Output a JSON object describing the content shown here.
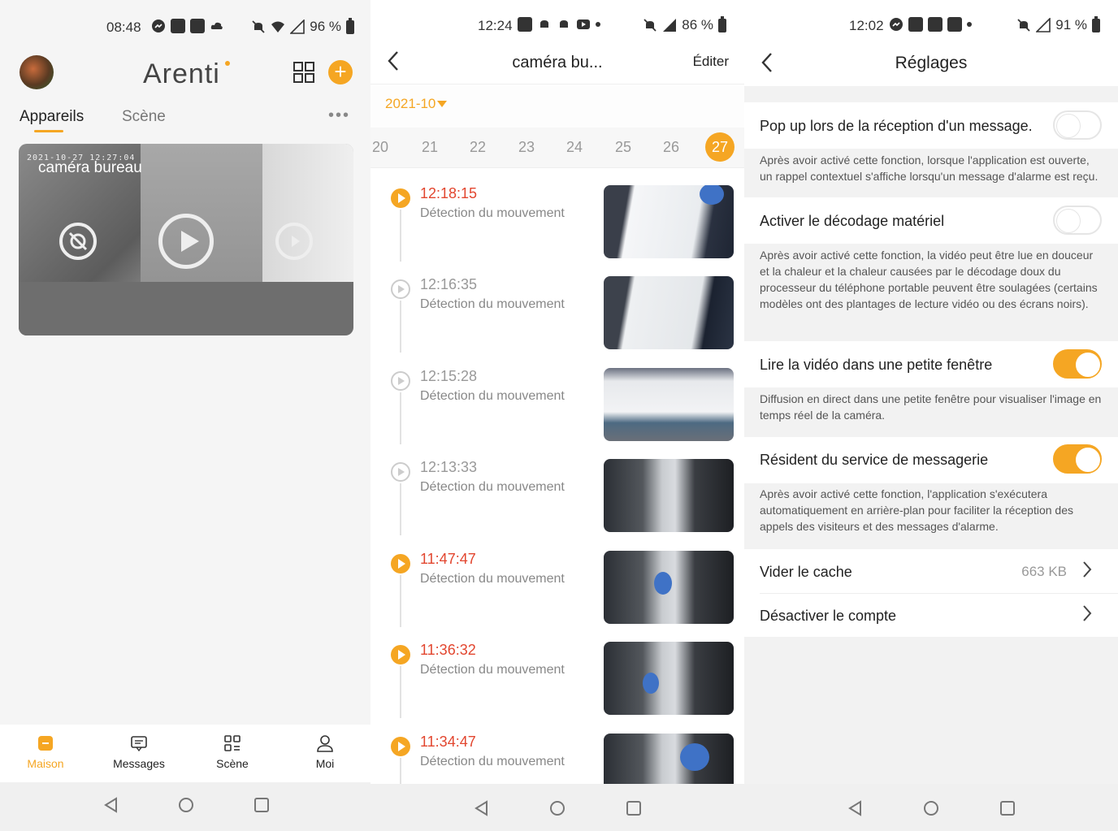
{
  "panel1": {
    "status": {
      "time": "08:48",
      "battery": "96 %"
    },
    "logo": "Arenti",
    "tabs": [
      {
        "label": "Appareils"
      },
      {
        "label": "Scène"
      }
    ],
    "more": "•••",
    "camera": {
      "timestamp": "2021-10-27 12:27:04",
      "name": "caméra bureau"
    },
    "bottom_nav": [
      {
        "label": "Maison",
        "icon": "home-icon"
      },
      {
        "label": "Messages",
        "icon": "message-icon"
      },
      {
        "label": "Scène",
        "icon": "scene-grid-icon"
      },
      {
        "label": "Moi",
        "icon": "person-icon"
      }
    ],
    "add_symbol": "+"
  },
  "panel2": {
    "status": {
      "time": "12:24",
      "battery": "86 %"
    },
    "title": "caméra bu...",
    "edit": "Éditer",
    "month": "2021-10",
    "days": [
      "20",
      "21",
      "22",
      "23",
      "24",
      "25",
      "26",
      "27"
    ],
    "active_day": "27",
    "events": [
      {
        "time": "12:18:15",
        "label": "Détection du mouvement",
        "unread": true
      },
      {
        "time": "12:16:35",
        "label": "Détection du mouvement",
        "unread": false
      },
      {
        "time": "12:15:28",
        "label": "Détection du mouvement",
        "unread": false
      },
      {
        "time": "12:13:33",
        "label": "Détection du mouvement",
        "unread": false
      },
      {
        "time": "11:47:47",
        "label": "Détection du mouvement",
        "unread": true
      },
      {
        "time": "11:36:32",
        "label": "Détection du mouvement",
        "unread": true
      },
      {
        "time": "11:34:47",
        "label": "Détection du mouvement",
        "unread": true
      }
    ]
  },
  "panel3": {
    "status": {
      "time": "12:02",
      "battery": "91 %"
    },
    "title": "Réglages",
    "settings": [
      {
        "label": "Pop up lors de la réception d'un message.",
        "on": false,
        "desc": "Après avoir activé cette fonction, lorsque l'application est ouverte, un rappel contextuel s'affiche lorsqu'un message d'alarme est reçu."
      },
      {
        "label": "Activer le décodage matériel",
        "on": false,
        "desc": "Après avoir activé cette fonction, la vidéo peut être lue en douceur et la chaleur et la chaleur causées par le décodage doux du processeur du téléphone portable peuvent être soulagées (certains modèles ont des plantages de lecture vidéo ou des écrans noirs)."
      },
      {
        "label": "Lire la vidéo dans une petite fenêtre",
        "on": true,
        "desc": "Diffusion en direct dans une petite fenêtre pour visualiser l'image en temps réel de la caméra."
      },
      {
        "label": "Résident du service de messagerie",
        "on": true,
        "desc": "Après avoir activé cette fonction, l'application s'exécutera automatiquement en arrière-plan pour faciliter la réception des appels des visiteurs et des messages d'alarme."
      }
    ],
    "cache": {
      "label": "Vider le cache",
      "value": "663 KB"
    },
    "deactivate": {
      "label": "Désactiver le compte"
    }
  },
  "colors": {
    "accent": "#f5a623",
    "alert_time": "#e2462f"
  }
}
